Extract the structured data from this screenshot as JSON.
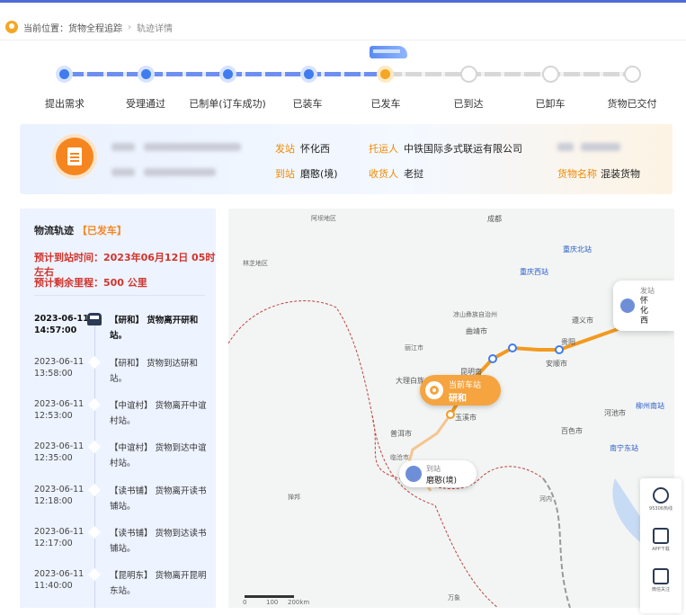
{
  "breadcrumb": {
    "label": "当前位置：",
    "parent": "货物全程追踪",
    "separator": "›",
    "current": "轨迹详情"
  },
  "progress": {
    "current_index": 4,
    "steps": [
      {
        "label": "提出需求",
        "state": "done"
      },
      {
        "label": "受理通过",
        "state": "done"
      },
      {
        "label": "已制单(订车成功)",
        "state": "done"
      },
      {
        "label": "已装车",
        "state": "done"
      },
      {
        "label": "已发车",
        "state": "current"
      },
      {
        "label": "已到达",
        "state": "todo"
      },
      {
        "label": "已卸车",
        "state": "todo"
      },
      {
        "label": "货物已交付",
        "state": "todo"
      }
    ]
  },
  "info": {
    "from_label": "发站",
    "from_value": "怀化西",
    "to_label": "到站",
    "to_value": "磨憨(境)",
    "shipper_label": "托运人",
    "shipper_value": "中铁国际多式联运有限公司",
    "consignee_label": "收货人",
    "consignee_value": "老挝",
    "cargo_label": "货物名称",
    "cargo_value": "混装货物"
  },
  "track": {
    "title": "物流轨迹",
    "status": "【已发车】",
    "eta": "预计到站时间：2023年06月12日 05时 左右",
    "remaining": "预计剩余里程：500 公里",
    "events": [
      {
        "time": "2023-06-11 14:57:00",
        "desc": "【研和】 货物离开研和站。"
      },
      {
        "time": "2023-06-11 13:58:00",
        "desc": "【研和】 货物到达研和站。"
      },
      {
        "time": "2023-06-11 12:53:00",
        "desc": "【中谊村】 货物离开中谊村站。"
      },
      {
        "time": "2023-06-11 12:35:00",
        "desc": "【中谊村】 货物到达中谊村站。"
      },
      {
        "time": "2023-06-11 12:18:00",
        "desc": "【读书铺】 货物离开读书铺站。"
      },
      {
        "time": "2023-06-11 12:17:00",
        "desc": "【读书铺】 货物到达读书铺站。"
      },
      {
        "time": "2023-06-11 11:40:00",
        "desc": "【昆明东】 货物离开昆明东站。"
      }
    ]
  },
  "map": {
    "current_label": "当前车站",
    "current_station": "研和",
    "from_label": "发站",
    "from_station": "怀化西",
    "to_label": "到站",
    "to_station": "磨憨(境)",
    "route_color": "#f5a623",
    "cities": [
      {
        "name": "成都"
      },
      {
        "name": "重庆北站"
      },
      {
        "name": "重庆西站"
      },
      {
        "name": "贵阳"
      },
      {
        "name": "遵义市"
      },
      {
        "name": "安顺市"
      },
      {
        "name": "曲靖市"
      },
      {
        "name": "玉溪市"
      },
      {
        "name": "大理白族自治州"
      },
      {
        "name": "普洱市"
      },
      {
        "name": "柳州南站"
      },
      {
        "name": "南宁东站"
      },
      {
        "name": "河池市"
      },
      {
        "name": "百色市"
      },
      {
        "name": "昆明南"
      },
      {
        "name": "阿坝地区"
      },
      {
        "name": "林芝地区"
      },
      {
        "name": "丽江市"
      },
      {
        "name": "凉山彝族自治州"
      },
      {
        "name": "临沧市"
      },
      {
        "name": "掸邦"
      },
      {
        "name": "万象"
      },
      {
        "name": "河内"
      }
    ],
    "scale": [
      "0",
      "100",
      "200km"
    ]
  },
  "side_tools": [
    {
      "label": "95306热线",
      "icon": "phone-icon"
    },
    {
      "label": "APP下载",
      "icon": "qrcode-icon"
    },
    {
      "label": "微信关注",
      "icon": "qrcode-icon"
    }
  ]
}
